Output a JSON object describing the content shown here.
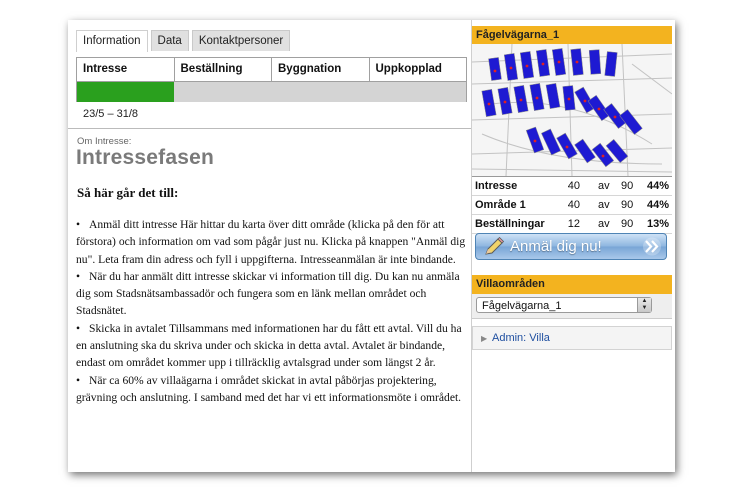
{
  "tabs": [
    "Information",
    "Data",
    "Kontaktpersoner"
  ],
  "progress": {
    "steps": [
      "Intresse",
      "Beställning",
      "Byggnation",
      "Uppkopplad"
    ],
    "completed_steps": 1,
    "bar_color": "#2aa01e",
    "dates": "23/5 – 31/8"
  },
  "main": {
    "subhead": "Om Intresse:",
    "title": "Intressefasen",
    "section_heading": "Så här går det till:",
    "bullets": [
      "Anmäl ditt intresse Här hittar du karta över ditt område (klicka på den för att förstora) och information om vad som pågår just nu. Klicka på knappen \"Anmäl dig nu\". Leta fram din adress och fyll i uppgifterna. Intresseanmälan är inte bindande.",
      "När du har anmält ditt intresse skickar vi information till dig. Du kan nu anmäla dig som Stadsnätsambassadör och fungera som en länk mellan området och Stadsnätet.",
      "Skicka in avtalet Tillsammans med informationen har du fått ett avtal. Vill du ha en anslutning ska du skriva under och skicka in detta avtal. Avtalet är bindande, endast om området kommer upp i tillräcklig avtalsgrad under som längst 2 år.",
      "När ca 60% av villaägarna i området skickat in avtal påbörjas projektering, grävning och anslutning. I samband med det har vi ett informationsmöte i området."
    ]
  },
  "sidebar": {
    "area_name": "Fågelvägarna_1",
    "stats": [
      {
        "label": "Intresse",
        "count": "40",
        "av": "av",
        "total": "90",
        "percent": "44%"
      },
      {
        "label": "Område 1",
        "count": "40",
        "av": "av",
        "total": "90",
        "percent": "44%"
      },
      {
        "label": "Beställningar",
        "count": "12",
        "av": "av",
        "total": "90",
        "percent": "13%"
      }
    ],
    "apply_button": "Anmäl dig nu!",
    "villa_header": "Villaområden",
    "villa_select_value": "Fågelvägarna_1",
    "admin_link": "Admin: Villa",
    "accent_color": "#f3b31f"
  },
  "icons": [
    "pencil-icon",
    "double-chevron-right-icon",
    "select-arrows-icon",
    "triangle-right-icon"
  ]
}
